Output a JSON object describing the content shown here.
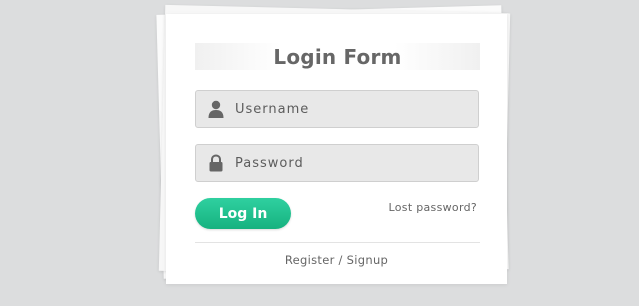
{
  "form": {
    "title": "Login Form",
    "username": {
      "placeholder": "Username",
      "value": "",
      "icon": "user-icon"
    },
    "password": {
      "placeholder": "Password",
      "value": "",
      "icon": "lock-icon"
    },
    "login_label": "Log In",
    "lost_password_label": "Lost password?",
    "register_label": "Register / Signup"
  },
  "colors": {
    "background": "#dcddde",
    "card": "#ffffff",
    "button_gradient_top": "#2fd0a0",
    "button_gradient_bottom": "#16b27f",
    "field_background": "#e8e8e8",
    "text": "#676767"
  }
}
